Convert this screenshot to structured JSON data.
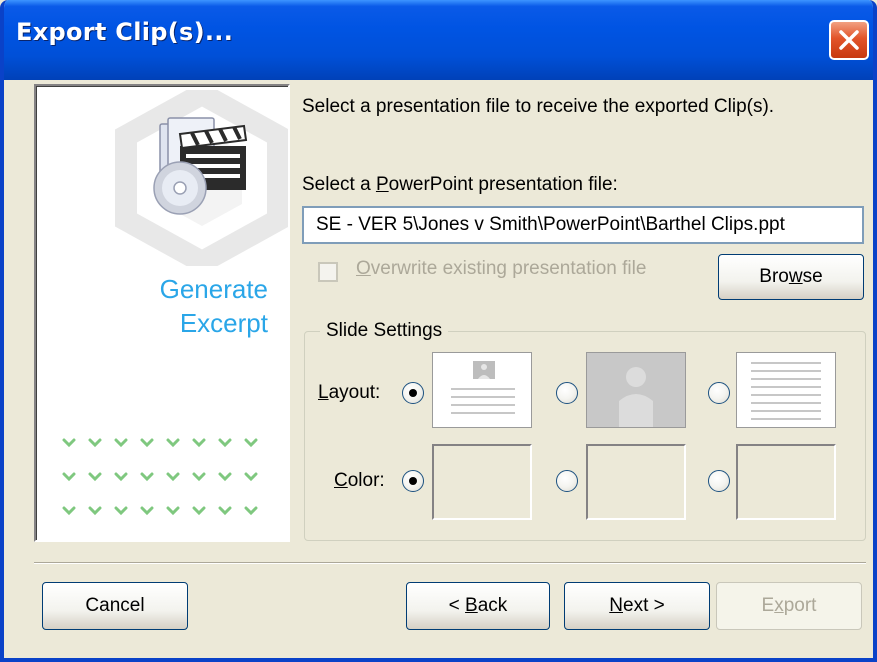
{
  "window": {
    "title": "Export Clip(s)..."
  },
  "left_panel": {
    "line1": "Generate",
    "line2": "Excerpt"
  },
  "instruction": "Select a presentation file to receive the exported Clip(s).",
  "file": {
    "label_pre": "Select a ",
    "label_accel": "P",
    "label_post": "owerPoint presentation file:",
    "value": "SE - VER 5\\Jones v Smith\\PowerPoint\\Barthel Clips.ppt"
  },
  "overwrite": {
    "label_accel": "O",
    "label_rest": "verwrite existing presentation file",
    "checked": false,
    "enabled": false
  },
  "browse": {
    "label_pre": "Bro",
    "label_accel": "w",
    "label_post": "se"
  },
  "slide_settings": {
    "title": "Slide Settings",
    "layout": {
      "label_accel": "L",
      "label_rest": "ayout:",
      "selected_index": 0
    },
    "color": {
      "label_accel": "C",
      "label_rest": "olor:",
      "selected_index": 0
    }
  },
  "buttons": {
    "cancel": "Cancel",
    "back": {
      "pre": "< ",
      "accel": "B",
      "post": "ack"
    },
    "next": {
      "accel": "N",
      "post": "ext >"
    },
    "export": {
      "pre": "E",
      "accel": "x",
      "post": "port",
      "enabled": false
    }
  },
  "colors": {
    "accent_text": "#2aa6e8",
    "title_bar": "#0054e3",
    "close_button": "#e2542a"
  }
}
